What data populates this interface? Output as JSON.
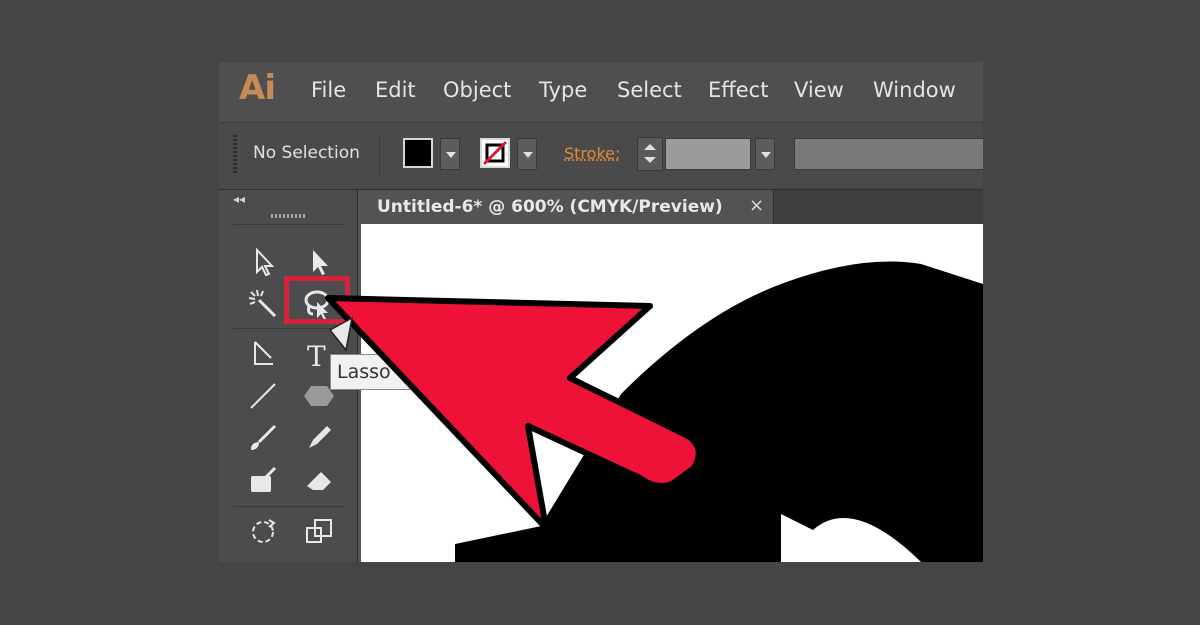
{
  "app": {
    "logo": "Ai"
  },
  "menu": {
    "items": [
      "File",
      "Edit",
      "Object",
      "Type",
      "Select",
      "Effect",
      "View",
      "Window"
    ]
  },
  "control_bar": {
    "selection_label": "No Selection",
    "stroke_label": "Stroke:"
  },
  "toolbar": {
    "collapse_glyph": "◂◂",
    "tools": [
      "selection-tool",
      "direct-selection-tool",
      "magic-wand-tool",
      "lasso-tool",
      "pen-tool",
      "type-tool",
      "line-tool",
      "shape-tool",
      "paintbrush-tool",
      "pencil-tool",
      "blob-brush-tool",
      "eraser-tool",
      "rotate-tool",
      "scale-tool"
    ]
  },
  "document": {
    "tab_title": "Untitled-6* @ 600% (CMYK/Preview)",
    "close_glyph": "×"
  },
  "tooltip": {
    "text": "Lasso"
  },
  "colors": {
    "accent_orange": "#e08a3a",
    "logo": "#c98b55",
    "highlight_red": "#d7223d",
    "annotation_arrow": "#ee1138"
  }
}
